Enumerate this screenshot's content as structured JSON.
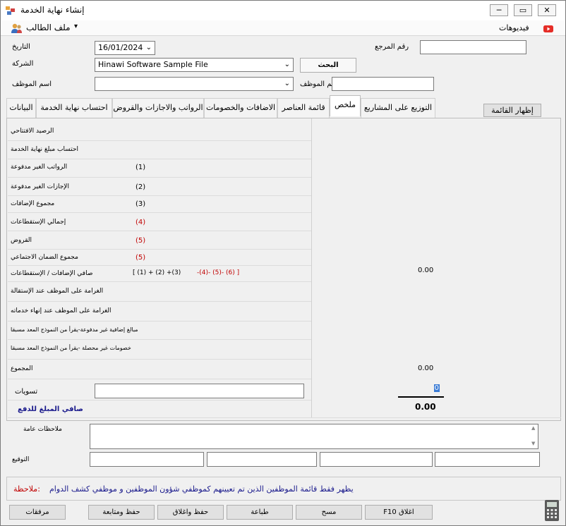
{
  "window": {
    "title": "إنشاء نهاية الخدمة",
    "minimize": "─",
    "restore": "▭",
    "close": "✕"
  },
  "menu": {
    "employee_file": "ملف الطالب",
    "dropdown_arrow": "▾",
    "videos": "فيديوهات"
  },
  "header": {
    "date_label": "التاريخ",
    "date_value": "16/01/2024",
    "company_label": "الشركة",
    "company_value": "Hinawi Software Sample File",
    "reference_label": "رقم المرجع",
    "reference_value": "",
    "search_button": "البحث",
    "employee_name_label": "اسم الموظف",
    "employee_name_value": "",
    "employee_number_label": "رقم الموظف",
    "employee_number_value": ""
  },
  "tabs": [
    {
      "label": "البيانات"
    },
    {
      "label": "احتساب نهاية الخدمة"
    },
    {
      "label": "الرواتب والاجازات والقروض"
    },
    {
      "label": "الاضافات والخصومات"
    },
    {
      "label": "قائمة العناصر"
    },
    {
      "label": "ملخص"
    },
    {
      "label": "التوزيع على المشاريع"
    }
  ],
  "show_list_button": "إظهار القائمة",
  "summary": {
    "rows": [
      {
        "label": "الرصيد الافتتاحي"
      },
      {
        "label": "احتساب مبلغ نهاية الخدمة"
      },
      {
        "label": "الرواتب الغير مدفوعة",
        "marker": "(1)"
      },
      {
        "label": "الإجازات الغير مدفوعة",
        "marker": "(2)"
      },
      {
        "label": "مجموع الإضافات",
        "marker": "(3)"
      },
      {
        "label": "إجمالي الإستقطاعات",
        "marker": "(4)"
      },
      {
        "label": "القروض",
        "marker": "(5)"
      },
      {
        "label": "مجموع الضمان الاجتماعي",
        "marker": "(5)"
      },
      {
        "label": "صافي الإضافات / الإستقطاعات"
      },
      {
        "label": "الغرامة على الموظف عند الإستقالة"
      },
      {
        "label": "الغرامة على الموظف عند إنهاء خدماته"
      },
      {
        "label": "مبالغ إضافية غير مدفوعة-يقرأ من النموذج المعد مسبقا"
      },
      {
        "label": "خصومات غير محصلة -يقرأ من النموذج المعد مسبقا"
      },
      {
        "label": "المجموع"
      },
      {
        "label": "تسويات"
      },
      {
        "label": "صافي المبلغ للدفع"
      }
    ],
    "formula_blue": "[ (1) + (2) +(3)",
    "formula_red": "-(4)- (5)- (6) ]",
    "net_additions_value": "0.00",
    "total_value": "0.00",
    "adjustments_text": "",
    "adjustments_value": "0",
    "net_payable_value": "0.00"
  },
  "notes": {
    "general_notes_label": "ملاحظات عامة",
    "general_notes_value": "",
    "signature_label": "التوقيع"
  },
  "note_bar": {
    "prefix": "ملاحظة:",
    "text": "يظهر فقط قائمة الموظفين الذين تم تعيينهم كموظفي شؤون الموظفين و موظفي كشف الدوام"
  },
  "buttons": {
    "attachments": "مرفقات",
    "save_continue": "حفظ ومتابعة",
    "save_close": "حفظ واغلاق",
    "print": "طباعة",
    "clear": "مسح",
    "close": "F10 اغلاق"
  },
  "colors": {
    "red": "#c00000",
    "blue": "#1a1a8c",
    "youtube": "#e52d27"
  }
}
